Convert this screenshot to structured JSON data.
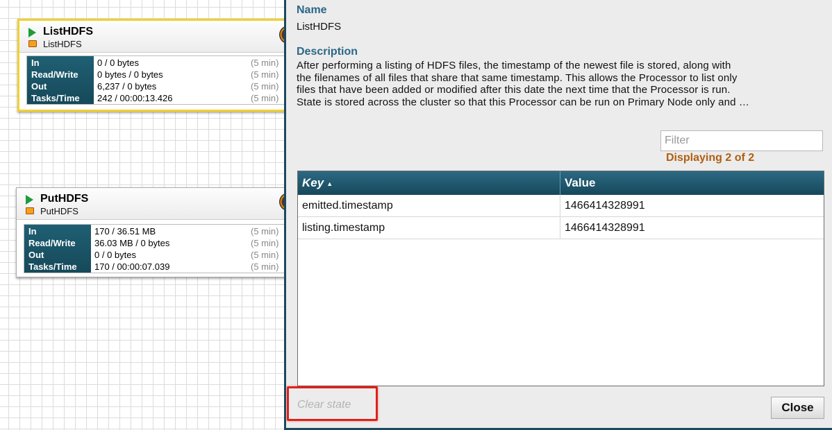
{
  "processors": [
    {
      "name": "ListHDFS",
      "type": "ListHDFS",
      "stats": [
        {
          "label": "In",
          "value": "0 / 0 bytes",
          "window": "(5 min)"
        },
        {
          "label": "Read/Write",
          "value": "0 bytes / 0 bytes",
          "window": "(5 min)"
        },
        {
          "label": "Out",
          "value": "6,237 / 0 bytes",
          "window": "(5 min)"
        },
        {
          "label": "Tasks/Time",
          "value": "242 / 00:00:13.426",
          "window": "(5 min)"
        }
      ]
    },
    {
      "name": "PutHDFS",
      "type": "PutHDFS",
      "stats": [
        {
          "label": "In",
          "value": "170 / 36.51 MB",
          "window": "(5 min)"
        },
        {
          "label": "Read/Write",
          "value": "36.03 MB / 0 bytes",
          "window": "(5 min)"
        },
        {
          "label": "Out",
          "value": "0 / 0 bytes",
          "window": "(5 min)"
        },
        {
          "label": "Tasks/Time",
          "value": "170 / 00:00:07.039",
          "window": "(5 min)"
        }
      ]
    }
  ],
  "dialog": {
    "name_label": "Name",
    "name_value": "ListHDFS",
    "description_label": "Description",
    "description_lines": [
      "After performing a listing of HDFS files, the timestamp of the newest file is stored, along with",
      "the filenames of all files that share that same timestamp. This allows the Processor to list only",
      "files that have been added or modified after this date the next time that the Processor is run.",
      "State is stored across the cluster so that this Processor can be run on Primary Node only and …"
    ],
    "filter_placeholder": "Filter",
    "display_count": "Displaying 2 of 2",
    "table": {
      "key_header": "Key",
      "value_header": "Value",
      "rows": [
        {
          "key": "emitted.timestamp",
          "value": "1466414328991"
        },
        {
          "key": "listing.timestamp",
          "value": "1466414328991"
        }
      ]
    },
    "clear_state_label": "Clear state",
    "close_label": "Close"
  },
  "colors": {
    "accent": "#2a6787",
    "header_bar": "#16485b",
    "count_text": "#b05e10",
    "selection": "#f2d12e",
    "highlight": "#e0201a"
  }
}
